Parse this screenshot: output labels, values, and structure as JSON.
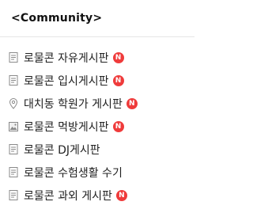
{
  "header": {
    "title": "<Community>"
  },
  "badge_color": "#ef3b3b",
  "items": [
    {
      "icon": "document-icon",
      "label": "로물콘 자유게시판",
      "badge": "N"
    },
    {
      "icon": "document-icon",
      "label": "로물콘 입시게시판",
      "badge": "N"
    },
    {
      "icon": "location-pin-icon",
      "label": "대치동 학원가 게시판",
      "badge": "N"
    },
    {
      "icon": "image-icon",
      "label": "로물콘 먹방게시판",
      "badge": "N"
    },
    {
      "icon": "document-icon",
      "label": "로물콘 DJ게시판"
    },
    {
      "icon": "document-icon",
      "label": "로물콘 수험생활 수기"
    },
    {
      "icon": "document-icon",
      "label": "로물콘 과외 게시판",
      "badge": "N"
    }
  ]
}
